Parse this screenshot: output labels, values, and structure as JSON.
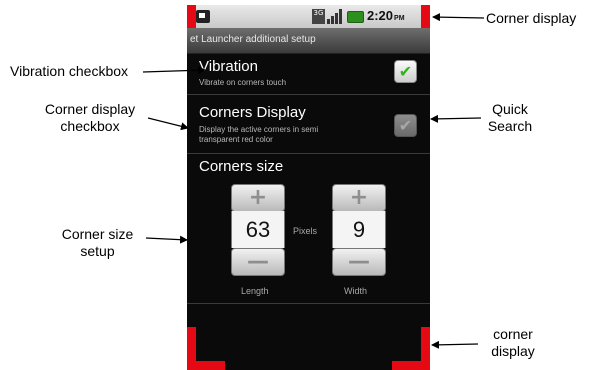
{
  "status_bar": {
    "network": "3G",
    "time": "2:20",
    "ampm": "PM",
    "icons": [
      "notification-icon",
      "3g-icon",
      "signal-icon",
      "battery-icon"
    ]
  },
  "title_bar": {
    "title": "et Launcher additional setup"
  },
  "vibration": {
    "title": "Vibration",
    "summary": "Vibrate on corners touch",
    "checked": true
  },
  "corners_display": {
    "title": "Corners Display",
    "summary_line1": "Display the active corners in semi",
    "summary_line2": "transparent red color",
    "checked": true,
    "enabled": false
  },
  "corners_size": {
    "heading": "Corners size",
    "plus_symbol": "+",
    "minus_symbol": "—",
    "unit_label": "Pixels",
    "length": {
      "value": "63",
      "label": "Length"
    },
    "width": {
      "value": "9",
      "label": "Width"
    }
  },
  "annotations": {
    "corner_display_top": "Corner display",
    "vibration_checkbox": "Vibration checkbox",
    "corner_display_checkbox_line1": "Corner display",
    "corner_display_checkbox_line2": "checkbox",
    "quick_search_line1": "Quick",
    "quick_search_line2": "Search",
    "corner_size_setup_line1": "Corner size",
    "corner_size_setup_line2": "setup",
    "corner_display_bottom_line1": "corner",
    "corner_display_bottom_line2": "display"
  },
  "colors": {
    "corner_red": "#e50914",
    "checkbox_green": "#2db51a",
    "screen_background": "#0a0a0a"
  }
}
